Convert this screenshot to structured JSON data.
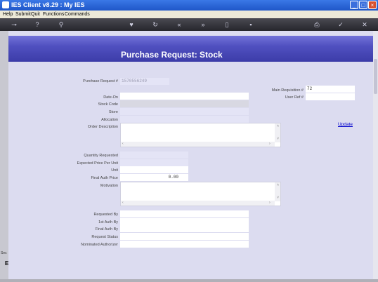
{
  "window": {
    "title": "IES Client v8.29 : My IES"
  },
  "menu": {
    "items": [
      "Help",
      "Submit",
      "Quit",
      "Functions",
      "Commands"
    ]
  },
  "page": {
    "title": "Purchase Request: Stock"
  },
  "form": {
    "purchase_request_label": "Purchase Request #",
    "purchase_request_value": "1570556249",
    "main_requisition_label": "Main Requisition #",
    "main_requisition_value": "72",
    "user_ref_label": "User Ref #",
    "user_ref_value": "",
    "date_on_label": "Date-On",
    "stock_code_label": "Stock Code",
    "store_label": "Store",
    "allocation_label": "Allocation",
    "order_description_label": "Order Description",
    "quantity_requested_label": "Quantity Requested",
    "expected_price_label": "Expected Price Per Unit",
    "unit_label": "Unit",
    "final_auth_price_label": "Final Auth Price",
    "final_auth_price_value": "0.00",
    "motivation_label": "Motivation",
    "requested_by_label": "Requested By",
    "first_auth_by_label": "1st Auth By",
    "final_auth_by_label": "Final Auth By",
    "request_status_label": "Request Status",
    "nominated_authorizer_label": "Nominated Authorizer",
    "update_link": "Update"
  },
  "leftstrip": {
    "t1": "Sec",
    "t2": "E"
  }
}
